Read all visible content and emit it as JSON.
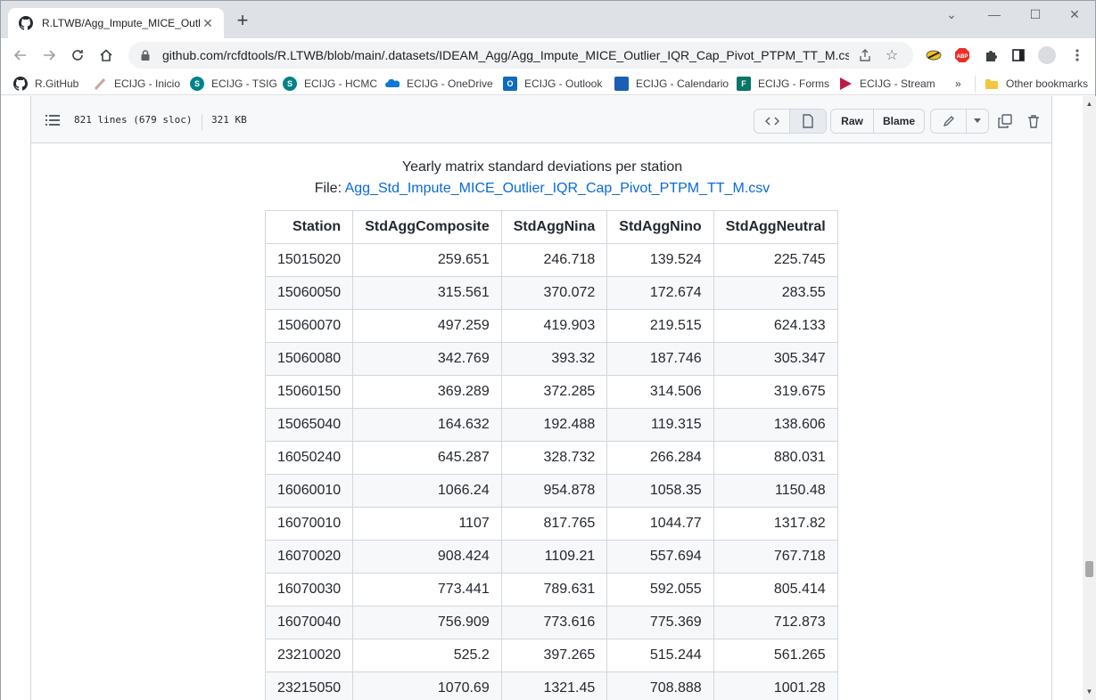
{
  "browser": {
    "tab_title": "R.LTWB/Agg_Impute_MICE_Outlier_IQR_Cap_Pivot_PTPM_TT_M.csv.md - GitHub",
    "url": "github.com/rcfdtools/R.LTWB/blob/main/.datasets/IDEAM_Agg/Agg_Impute_MICE_Outlier_IQR_Cap_Pivot_PTPM_TT_M.csv.md",
    "bookmarks": [
      {
        "label": "R.GitHub",
        "icon": "github-icon",
        "color": "#24292f"
      },
      {
        "label": "ECIJG - Inicio",
        "icon": "sharepoint-icon",
        "color": "#c9a7a0"
      },
      {
        "label": "ECIJG - TSIG",
        "icon": "sharepoint-icon",
        "color": "#038387"
      },
      {
        "label": "ECIJG - HCMC",
        "icon": "sharepoint-icon",
        "color": "#038387"
      },
      {
        "label": "ECIJG - OneDrive",
        "icon": "onedrive-icon",
        "color": "#0f78d4"
      },
      {
        "label": "ECIJG - Outlook",
        "icon": "outlook-icon",
        "color": "#0f6cbd"
      },
      {
        "label": "ECIJG - Calendario",
        "icon": "calendar-icon",
        "color": "#1a5fb4"
      },
      {
        "label": "ECIJG - Forms",
        "icon": "forms-icon",
        "color": "#077568"
      },
      {
        "label": "ECIJG - Stream",
        "icon": "stream-icon",
        "color": "#bc1948"
      }
    ],
    "more_bookmarks": "»",
    "other_bookmarks": "Other bookmarks",
    "ext_abp": "ABP"
  },
  "file": {
    "lines": "821 lines (679 sloc)",
    "size": "321 KB",
    "raw_label": "Raw",
    "blame_label": "Blame"
  },
  "document": {
    "title": "Yearly matrix standard deviations per station",
    "file_prefix": "File: ",
    "file_link": "Agg_Std_Impute_MICE_Outlier_IQR_Cap_Pivot_PTPM_TT_M.csv"
  },
  "table": {
    "headers": [
      "Station",
      "StdAggComposite",
      "StdAggNina",
      "StdAggNino",
      "StdAggNeutral"
    ],
    "rows": [
      [
        "15015020",
        "259.651",
        "246.718",
        "139.524",
        "225.745"
      ],
      [
        "15060050",
        "315.561",
        "370.072",
        "172.674",
        "283.55"
      ],
      [
        "15060070",
        "497.259",
        "419.903",
        "219.515",
        "624.133"
      ],
      [
        "15060080",
        "342.769",
        "393.32",
        "187.746",
        "305.347"
      ],
      [
        "15060150",
        "369.289",
        "372.285",
        "314.506",
        "319.675"
      ],
      [
        "15065040",
        "164.632",
        "192.488",
        "119.315",
        "138.606"
      ],
      [
        "16050240",
        "645.287",
        "328.732",
        "266.284",
        "880.031"
      ],
      [
        "16060010",
        "1066.24",
        "954.878",
        "1058.35",
        "1150.48"
      ],
      [
        "16070010",
        "1107",
        "817.765",
        "1044.77",
        "1317.82"
      ],
      [
        "16070020",
        "908.424",
        "1109.21",
        "557.694",
        "767.718"
      ],
      [
        "16070030",
        "773.441",
        "789.631",
        "592.055",
        "805.414"
      ],
      [
        "16070040",
        "756.909",
        "773.616",
        "775.369",
        "712.873"
      ],
      [
        "23210020",
        "525.2",
        "397.265",
        "515.244",
        "561.265"
      ],
      [
        "23215050",
        "1070.69",
        "1321.45",
        "708.888",
        "1001.28"
      ]
    ]
  }
}
